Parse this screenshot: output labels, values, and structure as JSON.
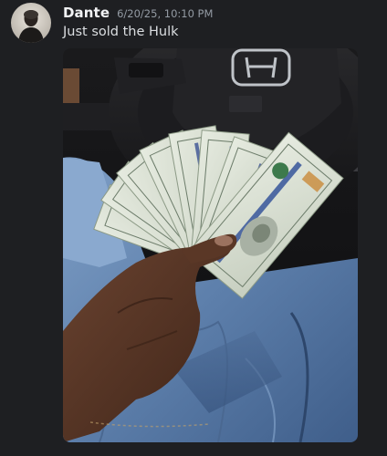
{
  "message": {
    "author": "Dante",
    "timestamp": "6/20/25, 10:10 PM",
    "content": "Just sold the Hulk"
  },
  "attachment": {
    "subject": "hand holding fanned stack of 100 dollar bills in front of a car steering wheel",
    "steering_wheel_logo": "car-brand-logo",
    "bill_denomination": "100"
  }
}
